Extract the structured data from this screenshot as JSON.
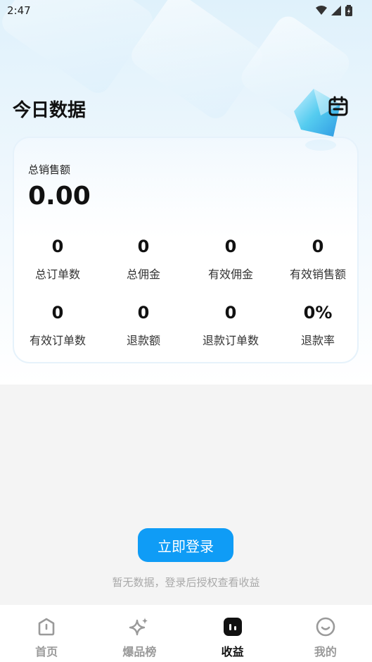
{
  "status_bar": {
    "time": "2:47"
  },
  "header": {
    "title": "今日数据",
    "calendar_icon": "calendar-icon"
  },
  "summary": {
    "total_sales_label": "总销售额",
    "total_sales_value": "0.00",
    "metrics": [
      {
        "value": "0",
        "label": "总订单数"
      },
      {
        "value": "0",
        "label": "总佣金"
      },
      {
        "value": "0",
        "label": "有效佣金"
      },
      {
        "value": "0",
        "label": "有效销售额"
      },
      {
        "value": "0",
        "label": "有效订单数"
      },
      {
        "value": "0",
        "label": "退款额"
      },
      {
        "value": "0",
        "label": "退款订单数"
      },
      {
        "value": "0%",
        "label": "退款率"
      }
    ]
  },
  "empty_state": {
    "login_button": "立即登录",
    "hint": "暂无数据，登录后授权查看收益"
  },
  "bottom_nav": {
    "items": [
      {
        "label": "首页",
        "icon": "home-icon"
      },
      {
        "label": "爆品榜",
        "icon": "sparkle-icon"
      },
      {
        "label": "收益",
        "icon": "earnings-icon",
        "active": true
      },
      {
        "label": "我的",
        "icon": "profile-icon"
      }
    ]
  },
  "colors": {
    "accent": "#0f9cf6",
    "active_nav": "#111111",
    "inactive_nav": "#9a9a9a"
  }
}
